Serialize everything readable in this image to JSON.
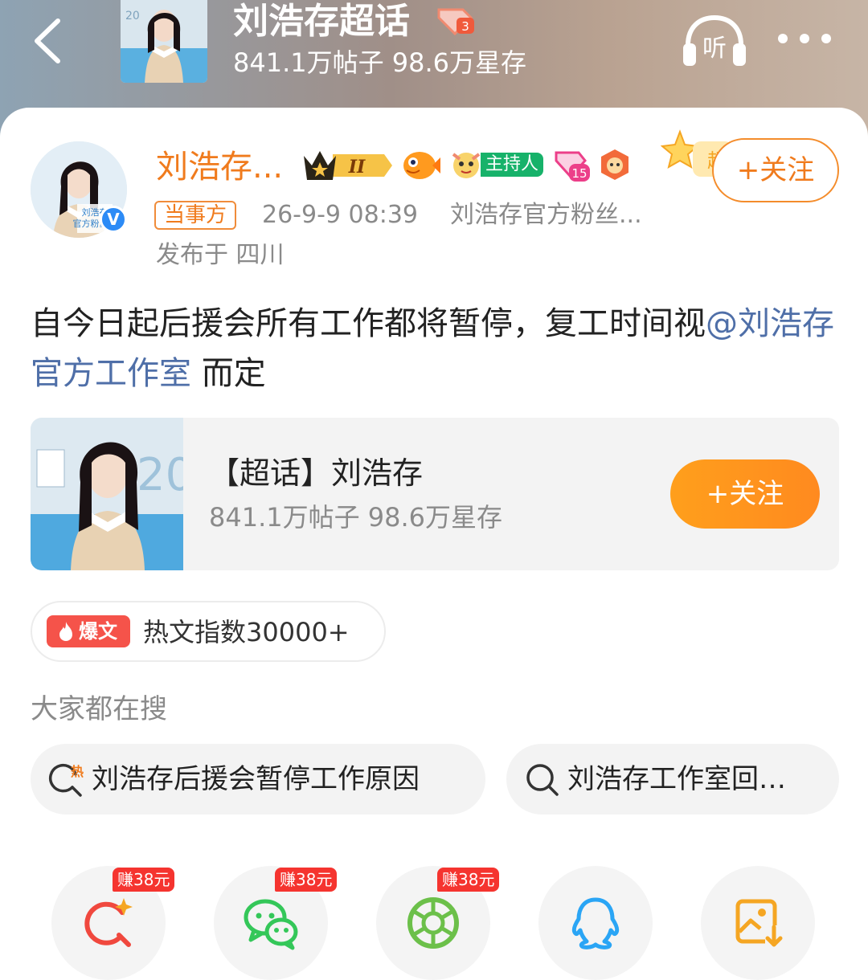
{
  "header": {
    "back_icon": "chevron-left-icon",
    "title": "刘浩存超话",
    "title_badge_level": "3",
    "stats": "841.1万帖子 98.6万星存",
    "listen_label": "听",
    "more_icon": "more-dots-icon"
  },
  "post": {
    "author_name": "刘浩存...",
    "crown_badge_level": "II",
    "host_badge_label": "主持人",
    "level_badge_number": "15",
    "follow_label": "+关注",
    "party_tag": "当事方",
    "time": "26-9-9 08:39",
    "source": "刘浩存官方粉丝...",
    "location": "发布于 四川",
    "body_text": "自今日起后援会所有工作都将暂停，复工时间视",
    "mention": "@刘浩存官方工作室",
    "body_suffix": " 而定"
  },
  "topic_card": {
    "title": "【超话】刘浩存",
    "stats": "841.1万帖子 98.6万星存",
    "follow_label": "+关注"
  },
  "hot": {
    "tag": "爆文",
    "text": "热文指数30000+"
  },
  "search": {
    "heading": "大家都在搜",
    "items": [
      {
        "text": "刘浩存后援会暂停工作原因",
        "icon": "hot-search-icon"
      },
      {
        "text": "刘浩存工作室回…",
        "icon": "search-icon"
      }
    ]
  },
  "share": {
    "items": [
      {
        "name": "share-weibo-search",
        "icon": "search-sparkle-icon",
        "earn": "赚38元",
        "color": "#f0483e"
      },
      {
        "name": "share-wechat",
        "icon": "wechat-icon",
        "earn": "赚38元",
        "color": "#34c759"
      },
      {
        "name": "share-moments",
        "icon": "moments-icon",
        "earn": "赚38元",
        "color": "#6cc04a"
      },
      {
        "name": "share-qq",
        "icon": "qq-icon",
        "earn": "",
        "color": "#2aa5f5"
      },
      {
        "name": "save-image",
        "icon": "save-image-icon",
        "earn": "",
        "color": "#f5a623"
      }
    ]
  }
}
